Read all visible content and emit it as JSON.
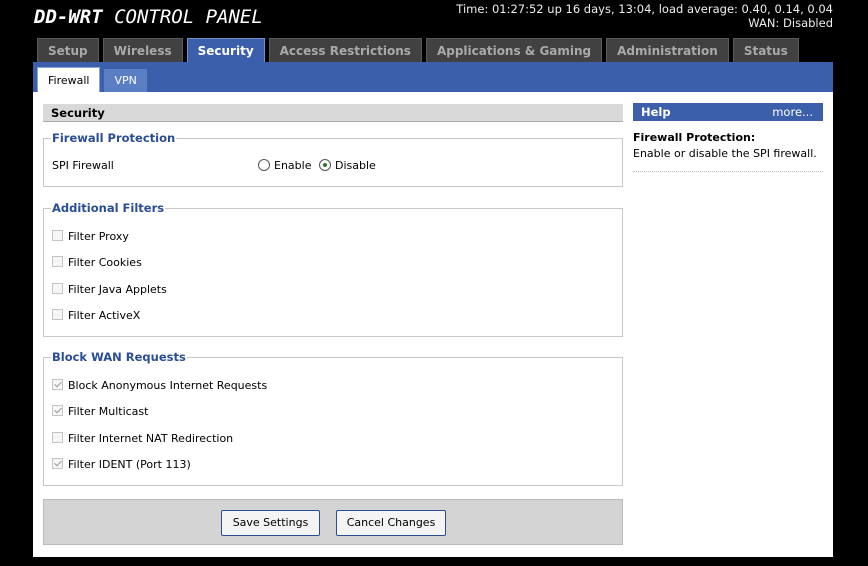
{
  "header": {
    "brand": "DD-WRT",
    "title": "CONTROL PANEL",
    "time_line": "Time: 01:27:52 up 16 days, 13:04, load average: 0.40, 0.14, 0.04",
    "wan_line": "WAN: Disabled"
  },
  "tabs": [
    "Setup",
    "Wireless",
    "Security",
    "Access Restrictions",
    "Applications & Gaming",
    "Administration",
    "Status"
  ],
  "subtabs": [
    "Firewall",
    "VPN"
  ],
  "main": {
    "section_title": "Security",
    "firewall": {
      "legend": "Firewall Protection",
      "spi_label": "SPI Firewall",
      "enable_label": "Enable",
      "disable_label": "Disable",
      "selected": "disable"
    },
    "filters": {
      "legend": "Additional Filters",
      "items": [
        {
          "label": "Filter Proxy",
          "checked": false
        },
        {
          "label": "Filter Cookies",
          "checked": false
        },
        {
          "label": "Filter Java Applets",
          "checked": false
        },
        {
          "label": "Filter ActiveX",
          "checked": false
        }
      ]
    },
    "wan": {
      "legend": "Block WAN Requests",
      "items": [
        {
          "label": "Block Anonymous Internet Requests",
          "checked": true
        },
        {
          "label": "Filter Multicast",
          "checked": true
        },
        {
          "label": "Filter Internet NAT Redirection",
          "checked": false
        },
        {
          "label": "Filter IDENT (Port 113)",
          "checked": true
        }
      ]
    },
    "buttons": {
      "save": "Save Settings",
      "cancel": "Cancel Changes"
    }
  },
  "help": {
    "title": "Help",
    "more": "more...",
    "topic": "Firewall Protection:",
    "text": "Enable or disable the SPI firewall."
  }
}
